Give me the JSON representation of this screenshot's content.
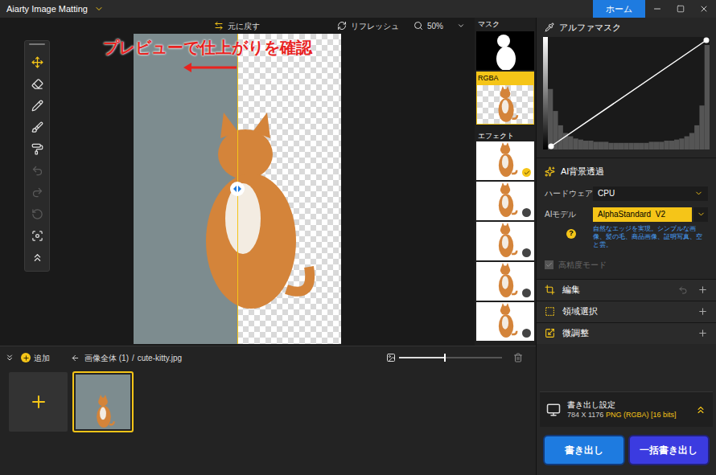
{
  "app": {
    "title": "Aiarty Image Matting",
    "home": "ホーム"
  },
  "toolbar": {
    "undo": "元に戻す",
    "refresh": "リフレッシュ",
    "zoom": "50%"
  },
  "annotation": "プレビューで仕上がりを確認",
  "tools": [
    {
      "kind": "move",
      "selected": true,
      "disabled": false
    },
    {
      "kind": "eraser",
      "selected": false,
      "disabled": false
    },
    {
      "kind": "restore",
      "selected": false,
      "disabled": false
    },
    {
      "kind": "brush",
      "selected": false,
      "disabled": false
    },
    {
      "kind": "roller",
      "selected": false,
      "disabled": false
    },
    {
      "kind": "undo",
      "selected": false,
      "disabled": true
    },
    {
      "kind": "redo",
      "selected": false,
      "disabled": true
    },
    {
      "kind": "reset",
      "selected": false,
      "disabled": true
    },
    {
      "kind": "frame",
      "selected": false,
      "disabled": false
    },
    {
      "kind": "collapse",
      "selected": false,
      "disabled": false
    }
  ],
  "preview": {
    "level": 0.5
  },
  "thumbnails": {
    "mask_label": "マスク",
    "rgba_label": "RGBA",
    "rgba_selected": true,
    "effects_label": "エフェクト",
    "effects": [
      {
        "selected": true
      },
      {
        "selected": false
      },
      {
        "selected": false
      },
      {
        "selected": false
      },
      {
        "selected": false
      }
    ]
  },
  "files": {
    "add": "追加",
    "breadcrumb": "画像全体 (1)",
    "separator": "/",
    "filename": "cute-kitty.jpg",
    "zoom_level": 0.44,
    "items": [
      {
        "selected": true
      }
    ]
  },
  "alpha": {
    "title": "アルファマスク",
    "curve": [
      0,
      1
    ],
    "histogram": [
      0.55,
      0.35,
      0.22,
      0.15,
      0.12,
      0.1,
      0.09,
      0.08,
      0.08,
      0.07,
      0.07,
      0.07,
      0.06,
      0.06,
      0.06,
      0.06,
      0.06,
      0.06,
      0.06,
      0.06,
      0.07,
      0.07,
      0.07,
      0.08,
      0.08,
      0.09,
      0.1,
      0.12,
      0.15,
      0.22,
      0.4,
      0.95
    ]
  },
  "ai": {
    "title": "AI背景透過",
    "hardware_label": "ハードウェア",
    "hardware": "CPU",
    "model_label": "AIモデル",
    "model": "AlphaStandard  V2",
    "help": "?",
    "description": "自然なエッジを実現。シンプルな画像、髪の毛、商品画像、証明写真、空と雲。",
    "precision": {
      "label": "高精度モード",
      "checked": true,
      "disabled": true
    }
  },
  "sections": [
    {
      "label": "編集",
      "kind": "edit",
      "undo": true
    },
    {
      "label": "領域選択",
      "kind": "select",
      "undo": false
    },
    {
      "label": "微調整",
      "kind": "adjust",
      "undo": false
    }
  ],
  "export": {
    "title": "書き出し設定",
    "size": "784 X 1176",
    "format": "PNG (RGBA) [16 bits]",
    "export": "書き出し",
    "batch": "一括書き出し"
  }
}
